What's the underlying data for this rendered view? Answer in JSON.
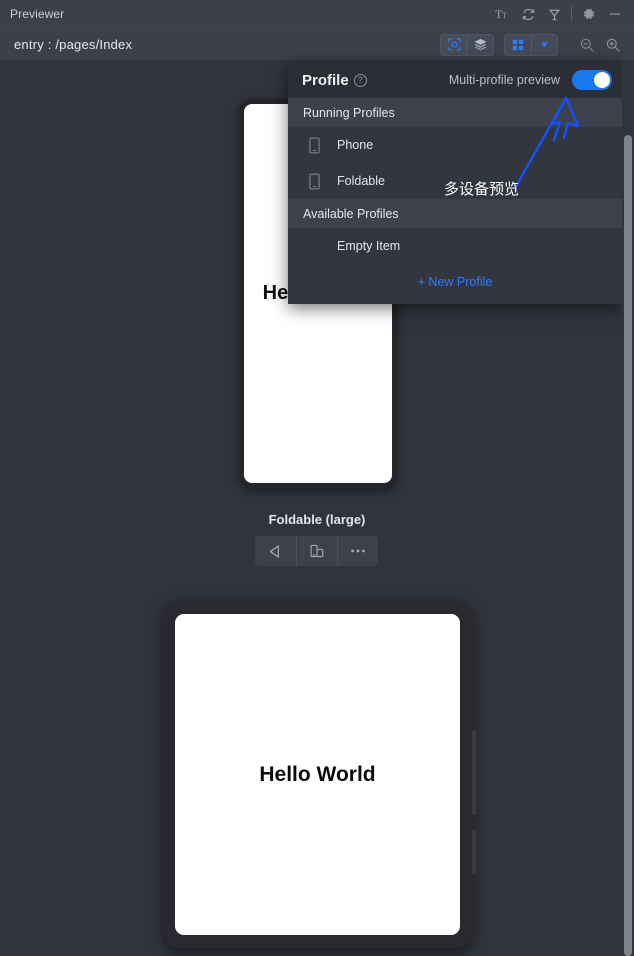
{
  "window": {
    "title": "Previewer",
    "icons": [
      {
        "name": "font-size-icon",
        "glyph": "Tт"
      },
      {
        "name": "refresh-icon",
        "glyph": "refresh"
      },
      {
        "name": "plug-icon",
        "glyph": "plug"
      },
      {
        "name": "settings-gear-icon",
        "glyph": "gear"
      },
      {
        "name": "minimize-icon",
        "glyph": "minimize"
      }
    ]
  },
  "entrybar": {
    "entry_text": "entry : /pages/Index",
    "inspector_icon": "inspect-element-icon",
    "layers_icon": "layers-icon",
    "grid_icon": "multi-profile-grid-icon",
    "dropdown_icon": "chevron-down-icon",
    "zoom_out_icon": "zoom-out-icon",
    "zoom_in_icon": "zoom-in-icon"
  },
  "profile_panel": {
    "title": "Profile",
    "help_glyph": "?",
    "multi_profile_label": "Multi-profile preview",
    "toggle_state": "on",
    "toggle_color": "#1878f0",
    "sections": [
      {
        "header": "Running Profiles",
        "items": [
          {
            "label": "Phone",
            "icon": "phone-device-icon"
          },
          {
            "label": "Foldable",
            "icon": "phone-device-icon"
          }
        ]
      },
      {
        "header": "Available Profiles",
        "items": [
          {
            "label": "Empty Item",
            "icon": null
          }
        ]
      }
    ],
    "new_profile_label": "+ New Profile",
    "new_profile_color": "#2f7bff"
  },
  "annotations": {
    "arrow_color": "#1351ff",
    "callout_text": "多设备预览"
  },
  "devices": [
    {
      "name": "phone-preview",
      "label": "",
      "screen_text": "Hello World",
      "visible_screen_text": "He"
    },
    {
      "name": "foldable-large-preview",
      "label": "Foldable (large)",
      "screen_text": "Hello World",
      "toolbar": [
        {
          "name": "rotate-left-icon"
        },
        {
          "name": "fold-device-icon"
        },
        {
          "name": "more-options-icon"
        }
      ]
    }
  ]
}
